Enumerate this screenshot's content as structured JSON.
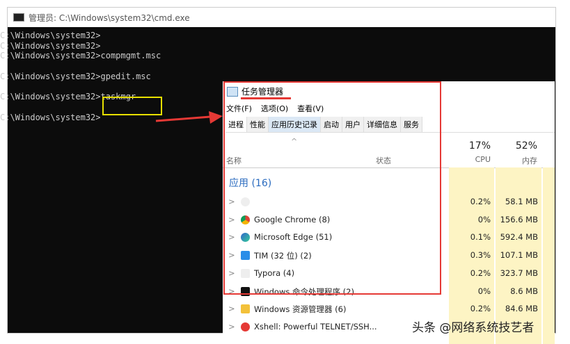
{
  "cmd": {
    "title": "管理员: C:\\Windows\\system32\\cmd.exe",
    "lines": [
      "C:\\Windows\\system32>",
      "C:\\Windows\\system32>",
      "C:\\Windows\\system32>compmgmt.msc",
      "",
      "C:\\Windows\\system32>gpedit.msc",
      "",
      "C:\\Windows\\system32>taskmgr",
      "",
      "C:\\Windows\\system32>"
    ]
  },
  "taskmgr": {
    "title": "任务管理器",
    "menu": [
      "文件(F)",
      "选项(O)",
      "查看(V)"
    ],
    "tabs": [
      "进程",
      "性能",
      "应用历史记录",
      "启动",
      "用户",
      "详细信息",
      "服务"
    ],
    "headers": {
      "name": "名称",
      "status": "状态",
      "cpu_pct": "17%",
      "cpu": "CPU",
      "mem_pct": "52%",
      "mem": "内存"
    },
    "group": "应用 (16)",
    "rows": [
      {
        "name": "",
        "cpu": "0.2%",
        "mem": "58.1 MB",
        "icon": "blurred-app-icon"
      },
      {
        "name": "Google Chrome (8)",
        "cpu": "0%",
        "mem": "156.6 MB",
        "icon": "chrome-icon"
      },
      {
        "name": "Microsoft Edge (51)",
        "cpu": "0.1%",
        "mem": "592.4 MB",
        "icon": "edge-icon"
      },
      {
        "name": "TIM (32 位) (2)",
        "cpu": "0.3%",
        "mem": "107.1 MB",
        "icon": "tim-icon"
      },
      {
        "name": "Typora (4)",
        "cpu": "0.2%",
        "mem": "323.7 MB",
        "icon": "typora-icon"
      },
      {
        "name": "Windows 命令处理程序 (2)",
        "cpu": "0%",
        "mem": "8.6 MB",
        "icon": "cmd-icon"
      },
      {
        "name": "Windows 资源管理器 (6)",
        "cpu": "0.2%",
        "mem": "84.6 MB",
        "icon": "explorer-icon"
      },
      {
        "name": "Xshell: Powerful TELNET/SSH...",
        "cpu": "",
        "mem": "",
        "icon": "xshell-icon"
      }
    ]
  },
  "watermark": "头条 @网络系统技艺者"
}
